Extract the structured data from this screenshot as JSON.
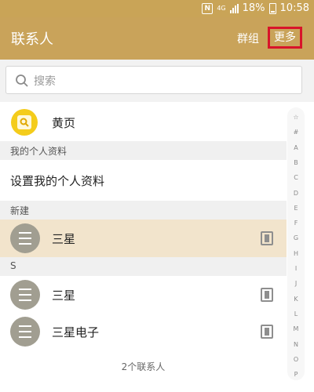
{
  "status_bar": {
    "battery": "18%",
    "time": "10:58",
    "nfc": "N",
    "net": "4G"
  },
  "app_bar": {
    "title": "联系人",
    "group_label": "群组",
    "more_label": "更多"
  },
  "search": {
    "placeholder": "搜索"
  },
  "yellow_pages": {
    "label": "黄页"
  },
  "sections": {
    "my_profile_header": "我的个人资料",
    "my_profile_setup": "设置我的个人资料",
    "new_header": "新建",
    "s_header": "S"
  },
  "contacts": {
    "new": [
      {
        "name": "三星"
      }
    ],
    "s": [
      {
        "name": "三星"
      },
      {
        "name": "三星电子"
      }
    ]
  },
  "footer": {
    "count_text": "2个联系人"
  },
  "index_letters": [
    "☆",
    "#",
    "A",
    "B",
    "C",
    "D",
    "E",
    "F",
    "G",
    "H",
    "I",
    "J",
    "K",
    "L",
    "M",
    "N",
    "O",
    "P"
  ],
  "colors": {
    "app_bar": "#c9a35a",
    "highlight_row": "#f2e4cc",
    "more_outline": "#d8142a"
  },
  "icons": {
    "search": "search-icon",
    "yellow_pages": "yellow-pages-icon",
    "card": "contact-card-icon",
    "avatar": "avatar-placeholder-icon"
  }
}
